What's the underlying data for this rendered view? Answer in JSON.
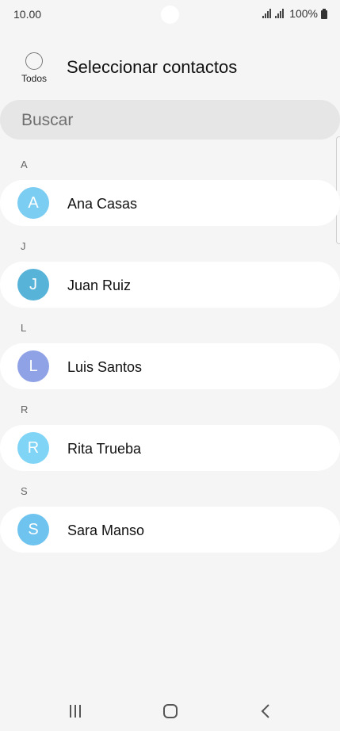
{
  "status_bar": {
    "time": "10.00",
    "battery": "100%"
  },
  "header": {
    "select_all_label": "Todos",
    "title": "Seleccionar contactos"
  },
  "search": {
    "placeholder": "Buscar"
  },
  "sections": [
    {
      "letter": "A",
      "contacts": [
        {
          "initial": "A",
          "name": "Ana Casas",
          "color": "#7ccdf2"
        }
      ]
    },
    {
      "letter": "J",
      "contacts": [
        {
          "initial": "J",
          "name": "Juan Ruiz",
          "color": "#58b3d8"
        }
      ]
    },
    {
      "letter": "L",
      "contacts": [
        {
          "initial": "L",
          "name": "Luis Santos",
          "color": "#8fa2e6"
        }
      ]
    },
    {
      "letter": "R",
      "contacts": [
        {
          "initial": "R",
          "name": "Rita Trueba",
          "color": "#80d4f5"
        }
      ]
    },
    {
      "letter": "S",
      "contacts": [
        {
          "initial": "S",
          "name": "Sara Manso",
          "color": "#6fc3ef"
        }
      ]
    }
  ],
  "icons": {
    "signal": "signal-icon",
    "battery": "battery-icon",
    "nav_recent": "recent-apps-icon",
    "nav_home": "home-icon",
    "nav_back": "back-icon"
  }
}
